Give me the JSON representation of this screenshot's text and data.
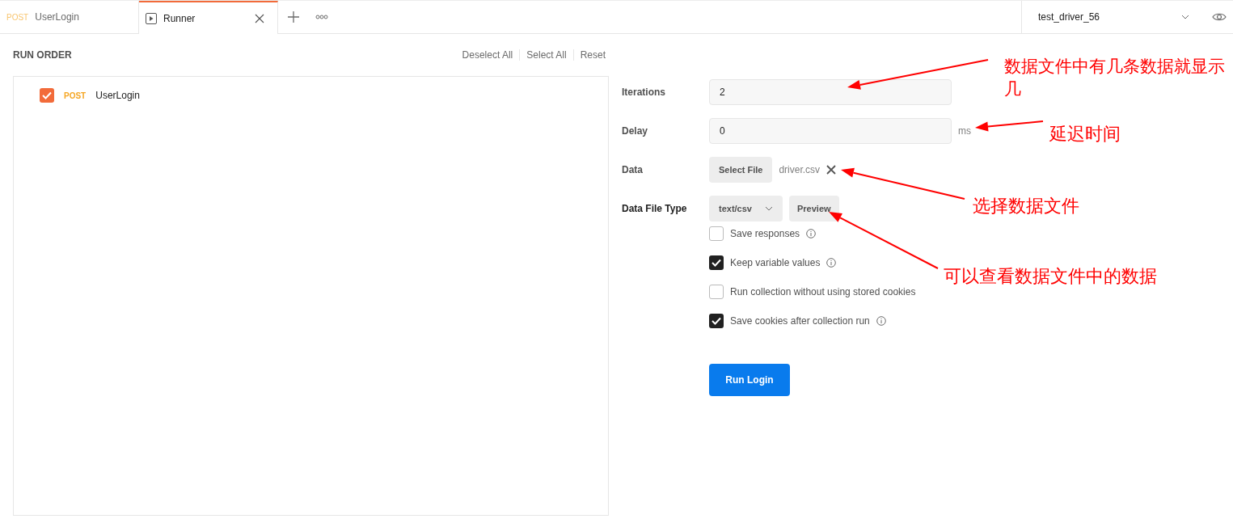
{
  "tabs": [
    {
      "kind": "request",
      "method": "POST",
      "label": "UserLogin",
      "selected": false
    },
    {
      "kind": "runner",
      "label": "Runner",
      "selected": true
    }
  ],
  "environment": {
    "value": "test_driver_56"
  },
  "run_order": {
    "title": "RUN ORDER",
    "actions": [
      "Deselect All",
      "Select All",
      "Reset"
    ],
    "items": [
      {
        "method": "POST",
        "name": "UserLogin",
        "checked": true
      }
    ]
  },
  "form": {
    "iterations": {
      "label": "Iterations",
      "value": "2"
    },
    "delay": {
      "label": "Delay",
      "value": "0",
      "unit": "ms"
    },
    "data": {
      "label": "Data",
      "button": "Select File",
      "file": "driver.csv"
    },
    "data_file_type": {
      "label": "Data File Type",
      "value": "text/csv",
      "preview": "Preview"
    },
    "options": [
      {
        "label": "Save responses",
        "checked": false,
        "info": true
      },
      {
        "label": "Keep variable values",
        "checked": true,
        "info": true
      },
      {
        "label": "Run collection without using stored cookies",
        "checked": false,
        "info": false
      },
      {
        "label": "Save cookies after collection run",
        "checked": true,
        "info": true
      }
    ],
    "run_button": "Run Login"
  },
  "annotations": [
    {
      "text": "数据文件中有几条数据就显示几"
    },
    {
      "text": "延迟时间"
    },
    {
      "text": "选择数据文件"
    },
    {
      "text": "可以查看数据文件中的数据"
    }
  ]
}
